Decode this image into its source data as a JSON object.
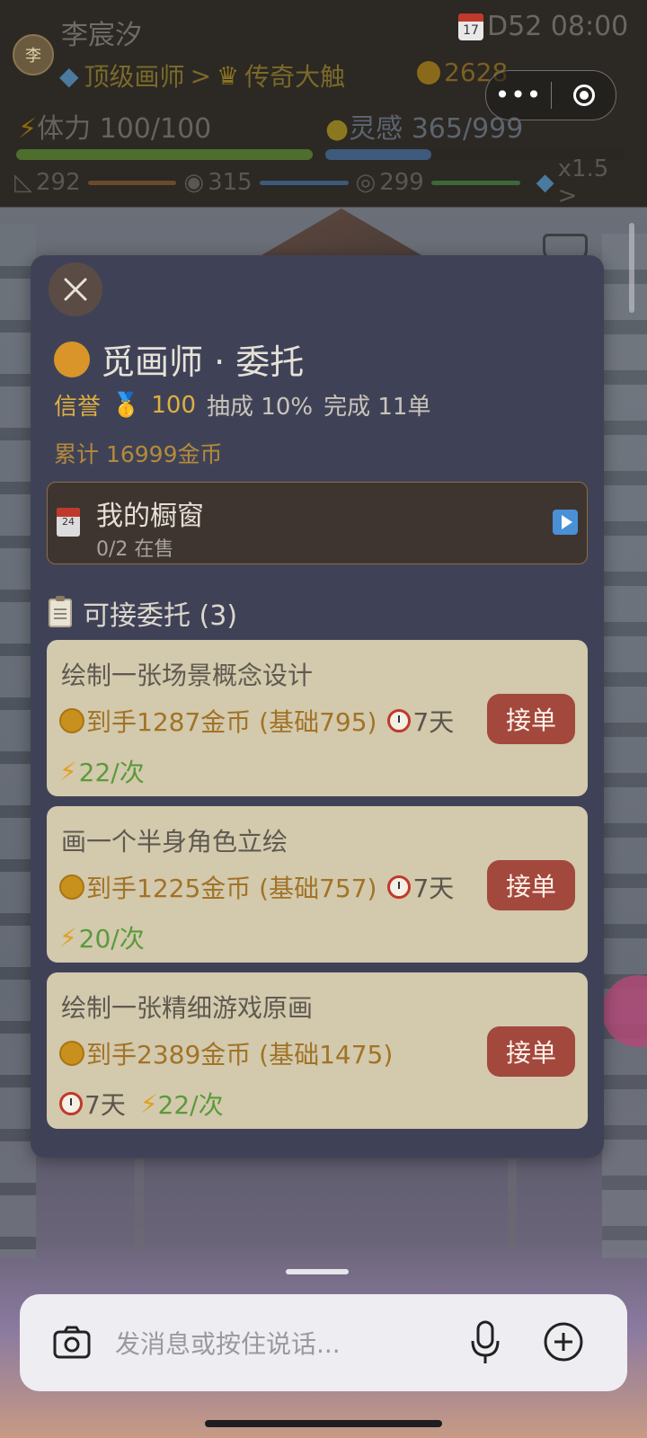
{
  "hud": {
    "avatar_char": "李",
    "name": "李宸汐",
    "calendar_day": "17",
    "date_time": "D52 08:00",
    "rank_current": "顶级画师",
    "rank_arrow": ">",
    "rank_next": "传奇大触",
    "coins": "2628",
    "stamina": "体力 100/100",
    "inspiration": "灵感 365/999",
    "skill_1": "292",
    "skill_2": "315",
    "skill_3": "299",
    "multiplier": "x1.5 >",
    "capsule_more": "•••"
  },
  "panel": {
    "title": "觅画师 · 委托",
    "reputation_label": "信誉",
    "reputation_value": "100",
    "commission_rate": "抽成 10%",
    "completed": "完成 11单",
    "total_earned": "累计 16999金币"
  },
  "showcase": {
    "icon_text": "24",
    "title": "我的橱窗",
    "status": "0/2 在售"
  },
  "section": {
    "title": "可接委托 (3)"
  },
  "commissions": [
    {
      "title": "绘制一张场景概念设计",
      "reward": "到手1287金币 (基础795)",
      "days": "7天",
      "energy": "22/次",
      "button": "接单"
    },
    {
      "title": "画一个半身角色立绘",
      "reward": "到手1225金币 (基础757)",
      "days": "7天",
      "energy": "20/次",
      "button": "接单"
    },
    {
      "title": "绘制一张精细游戏原画",
      "reward": "到手2389金币 (基础1475)",
      "days": "7天",
      "energy": "22/次",
      "button": "接单"
    }
  ],
  "chat": {
    "placeholder": "发消息或按住说话..."
  },
  "colors": {
    "panel_bg": "#3f4257",
    "card_bg": "#d3c9ad",
    "accept_button": "#a3483d",
    "reward_gold": "#a17326",
    "energy_green": "#5a9a3a",
    "gold_text": "#e0b040"
  }
}
